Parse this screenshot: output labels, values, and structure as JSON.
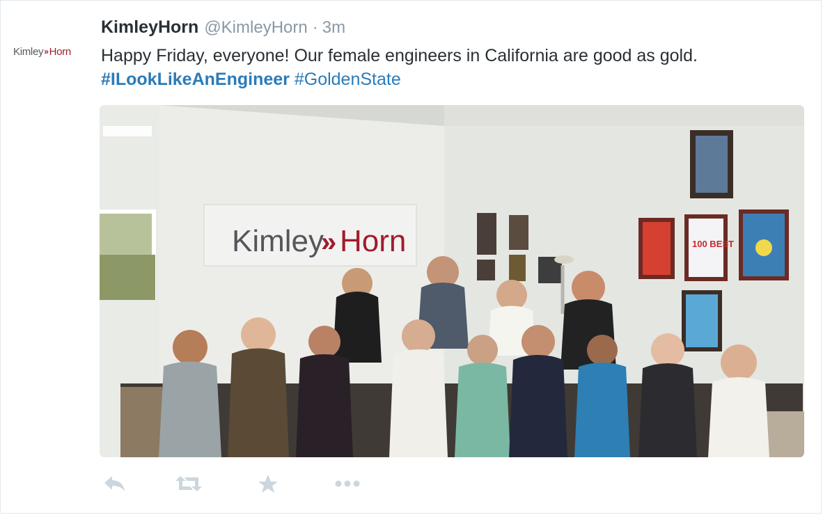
{
  "tweet": {
    "avatar": {
      "brand_left": "Kimley",
      "brand_arrows": "»",
      "brand_right": "Horn"
    },
    "fullname": "KimleyHorn",
    "screen_name": "@KimleyHorn",
    "separator": "·",
    "time": "3m",
    "text_line1": "Happy Friday, everyone! Our female engineers in California are good as gold.",
    "hashtag1": "#ILookLikeAnEngineer",
    "hashtag2": "#GoldenState",
    "media": {
      "sign_left": "Kimley",
      "sign_arrows": "»",
      "sign_right": "Horn",
      "plaque_text": "100 BEST"
    },
    "actions": [
      {
        "name": "reply",
        "icon": "reply-icon"
      },
      {
        "name": "retweet",
        "icon": "retweet-icon"
      },
      {
        "name": "favorite",
        "icon": "star-icon"
      },
      {
        "name": "more",
        "icon": "more-icon"
      }
    ]
  },
  "colors": {
    "text": "#292f33",
    "secondary": "#8899a6",
    "link": "#2b7bb9",
    "brand_red": "#a01c2c",
    "icon": "#ccd6dd"
  }
}
